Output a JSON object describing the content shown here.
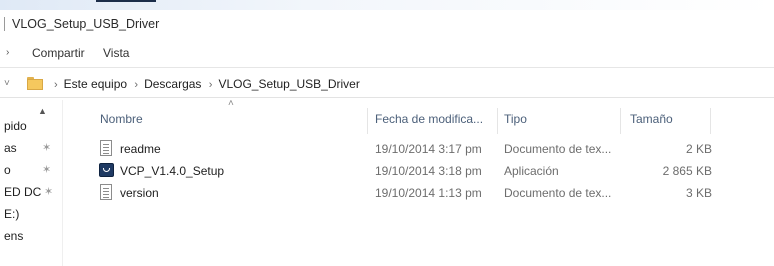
{
  "window": {
    "title": "VLOG_Setup_USB_Driver"
  },
  "ribbon": {
    "tabs": [
      "Compartir",
      "Vista"
    ]
  },
  "address": {
    "crumbs": [
      "Este equipo",
      "Descargas",
      "VLOG_Setup_USB_Driver"
    ]
  },
  "nav": {
    "items": [
      {
        "label": "pido",
        "pinned": false
      },
      {
        "label": "as",
        "pinned": true
      },
      {
        "label": "o",
        "pinned": true
      },
      {
        "label": "ED DC",
        "pinned": true
      },
      {
        "label": "E:)",
        "pinned": false
      },
      {
        "label": "ens",
        "pinned": false
      }
    ]
  },
  "columns": {
    "name": "Nombre",
    "date": "Fecha de modifica...",
    "type": "Tipo",
    "size": "Tamaño"
  },
  "files": [
    {
      "name": "readme",
      "date": "19/10/2014 3:17 pm",
      "type": "Documento de tex...",
      "size": "2 KB",
      "icon": "text-file-icon"
    },
    {
      "name": "VCP_V1.4.0_Setup",
      "date": "19/10/2014 3:18 pm",
      "type": "Aplicación",
      "size": "2 865 KB",
      "icon": "setup-app-icon"
    },
    {
      "name": "version",
      "date": "19/10/2014 1:13 pm",
      "type": "Documento de tex...",
      "size": "3 KB",
      "icon": "text-file-icon"
    }
  ]
}
